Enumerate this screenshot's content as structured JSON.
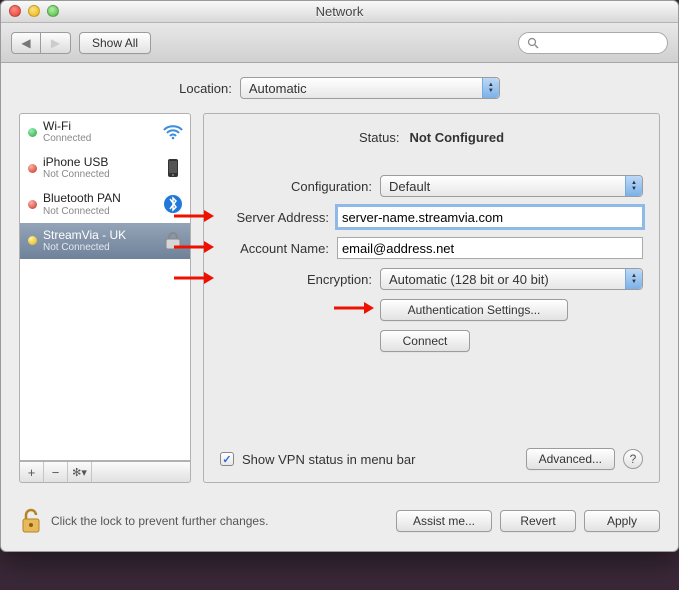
{
  "window": {
    "title": "Network"
  },
  "toolbar": {
    "show_all": "Show All",
    "search_placeholder": ""
  },
  "location": {
    "label": "Location:",
    "value": "Automatic"
  },
  "sidebar": {
    "items": [
      {
        "name": "Wi-Fi",
        "status": "Connected",
        "dot": "green",
        "icon": "wifi"
      },
      {
        "name": "iPhone USB",
        "status": "Not Connected",
        "dot": "red",
        "icon": "iphone"
      },
      {
        "name": "Bluetooth PAN",
        "status": "Not Connected",
        "dot": "red",
        "icon": "bluetooth"
      },
      {
        "name": "StreamVia - UK",
        "status": "Not Connected",
        "dot": "yellow",
        "icon": "lock",
        "selected": true
      }
    ]
  },
  "details": {
    "status_label": "Status:",
    "status_value": "Not Configured",
    "fields": {
      "configuration_label": "Configuration:",
      "configuration_value": "Default",
      "server_label": "Server Address:",
      "server_value": "server-name.streamvia.com",
      "account_label": "Account Name:",
      "account_value": "email@address.net",
      "encryption_label": "Encryption:",
      "encryption_value": "Automatic (128 bit or 40 bit)"
    },
    "auth_button": "Authentication Settings...",
    "connect_button": "Connect",
    "checkbox_label": "Show VPN status in menu bar",
    "checkbox_checked": true,
    "advanced_button": "Advanced..."
  },
  "footer": {
    "lock_text": "Click the lock to prevent further changes.",
    "assist": "Assist me...",
    "revert": "Revert",
    "apply": "Apply"
  }
}
